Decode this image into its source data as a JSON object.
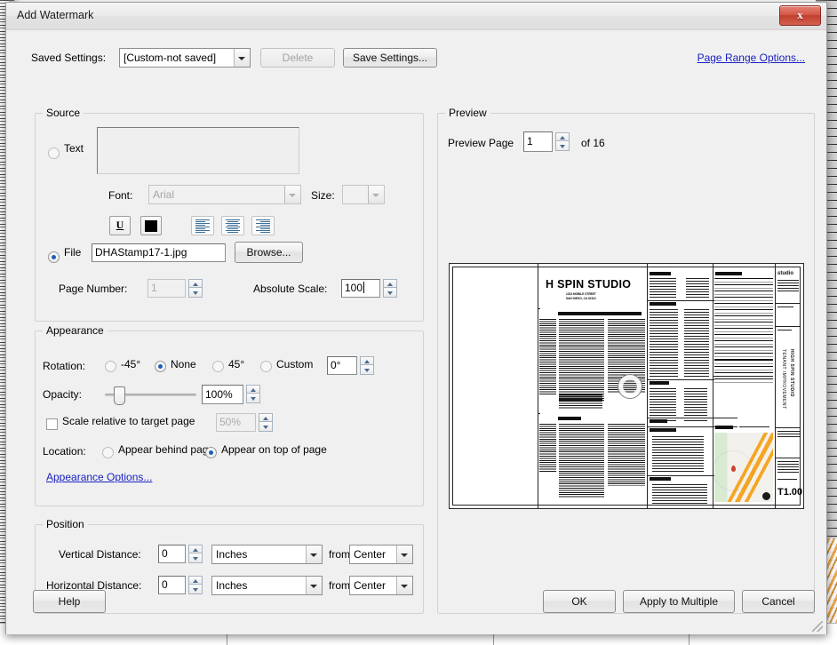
{
  "window": {
    "title": "Add Watermark",
    "close_label": "x"
  },
  "toolbar": {
    "saved_settings_label": "Saved Settings:",
    "saved_settings_value": "[Custom-not saved]",
    "delete_label": "Delete",
    "save_settings_label": "Save Settings...",
    "page_range_options_label": "Page Range Options..."
  },
  "source": {
    "group_title": "Source",
    "text_radio_label": "Text",
    "text_value": "",
    "font_label": "Font:",
    "font_value": "Arial",
    "size_label": "Size:",
    "size_value": "",
    "underline_label": "U",
    "color_swatch": "#000000",
    "align_left_name": "align-left",
    "align_center_name": "align-center",
    "align_right_name": "align-right",
    "file_radio_label": "File",
    "file_path_value": "DHAStamp17-1.jpg",
    "browse_label": "Browse...",
    "page_number_label": "Page Number:",
    "page_number_value": "1",
    "absolute_scale_label": "Absolute Scale:",
    "absolute_scale_value": "100"
  },
  "appearance": {
    "group_title": "Appearance",
    "rotation_label": "Rotation:",
    "rotation_neg45_label": "-45°",
    "rotation_none_label": "None",
    "rotation_45_label": "45°",
    "rotation_custom_label": "Custom",
    "rotation_custom_value": "0°",
    "opacity_label": "Opacity:",
    "opacity_value": "100%",
    "scale_relative_label": "Scale relative to target page",
    "scale_relative_value": "50%",
    "location_label": "Location:",
    "location_behind_label": "Appear behind page",
    "location_top_label": "Appear on top of page",
    "appearance_options_label": "Appearance Options..."
  },
  "position": {
    "group_title": "Position",
    "vertical_label": "Vertical Distance:",
    "vertical_value": "0",
    "vertical_unit": "Inches",
    "vertical_from_label": "from",
    "vertical_from_value": "Center",
    "horizontal_label": "Horizontal Distance:",
    "horizontal_value": "0",
    "horizontal_unit": "Inches",
    "horizontal_from_label": "from",
    "horizontal_from_value": "Center"
  },
  "preview": {
    "group_title": "Preview",
    "page_label": "Preview Page",
    "page_value": "1",
    "total_label": "of 16",
    "thumbnail": {
      "sheet_title": "H SPIN STUDIO",
      "sheet_address_line1": "1234 MOBILE STREET",
      "sheet_address_line2": "SAN DIEGO, CA 92101",
      "sheet_number": "T1.00",
      "vertical_title": "HIGH SPIN STUDIO",
      "vertical_sub": "TENANT IMPROVEMENT",
      "vertical_sub2": "SAN DIEGO, CA 92101",
      "logo_text": "studio",
      "sections": [
        "FIRE PROTECTION & FIRE RESISTIVE RATING REQUIREMENTS",
        "FIRE NOTES",
        "PROJECT TEAM",
        "PROJECT DIRECTORY",
        "PROJECT DATA",
        "SHEET INDEX",
        "DEFERRED APPROVALS",
        "ENERGY NOTES",
        "VICINITY MAP"
      ]
    }
  },
  "footer": {
    "help_label": "Help",
    "ok_label": "OK",
    "apply_multiple_label": "Apply to Multiple",
    "cancel_label": "Cancel"
  },
  "colors": {
    "link": "#1a21c4",
    "radio_dot": "#1c5fb4",
    "dialog_bg": "#f0f0f0",
    "close_button": "#c23f2f"
  }
}
